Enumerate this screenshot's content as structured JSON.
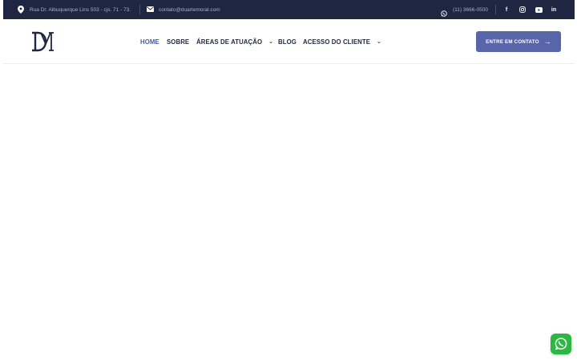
{
  "topbar": {
    "address": "Rua Dr. Albuquerque Lins 503 - cjs. 71 - 73.",
    "email": "contato@duartemoral.com",
    "phone": "(11) 3666-0500",
    "social": {
      "facebook": "f",
      "linkedin": "in"
    }
  },
  "header": {
    "logo_text": "DM",
    "nav": [
      {
        "label": "HOME",
        "active": true
      },
      {
        "label": "SOBRE"
      },
      {
        "label": "ÁREAS DE ATUAÇÃO",
        "has_dropdown": true
      },
      {
        "label": "BLOG"
      },
      {
        "label": "ACESSO DO CLIENTE",
        "has_dropdown": true
      }
    ],
    "cta_label": "ENTRE EM CONTATO"
  },
  "colors": {
    "topbar_bg": "#1f2642",
    "accent": "#5965a9",
    "nav_active": "#4c58a3",
    "whatsapp": "#2bb741"
  },
  "icons": [
    "map-pin-icon",
    "envelope-icon",
    "whatsapp-icon",
    "facebook-icon",
    "instagram-icon",
    "youtube-icon",
    "linkedin-icon",
    "arrow-right-icon",
    "chevron-down-icon"
  ]
}
